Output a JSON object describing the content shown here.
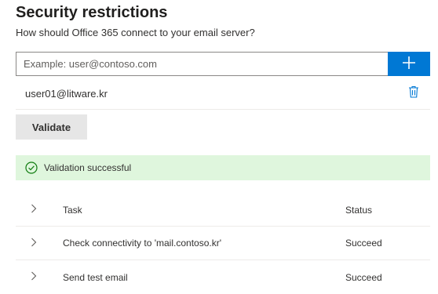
{
  "header": {
    "title": "Security restrictions",
    "subtitle": "How should Office 365 connect to your email server?"
  },
  "email_input": {
    "placeholder": "Example: user@contoso.com",
    "value": "",
    "add_icon": "plus-icon"
  },
  "email_list": [
    {
      "address": "user01@litware.kr",
      "delete_icon": "trash-icon"
    }
  ],
  "validate_label": "Validate",
  "validation": {
    "message": "Validation successful",
    "icon": "check-circle-icon",
    "color": "#dff6dd"
  },
  "tasks": {
    "columns": {
      "task": "Task",
      "status": "Status"
    },
    "rows": [
      {
        "task": "Check connectivity to 'mail.contoso.kr'",
        "status": "Succeed"
      },
      {
        "task": "Send test email",
        "status": "Succeed"
      }
    ]
  },
  "colors": {
    "accent": "#0078d4",
    "success_bg": "#dff6dd",
    "success_icon": "#107c10"
  }
}
